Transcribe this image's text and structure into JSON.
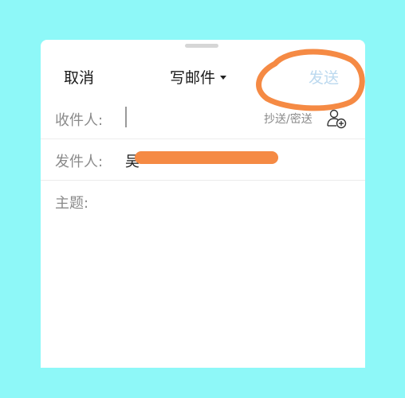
{
  "header": {
    "cancel_label": "取消",
    "title": "写邮件",
    "send_label": "发送",
    "send_color": "#bcd9ef"
  },
  "fields": {
    "to": {
      "label": "收件人:",
      "value": "",
      "cc_bcc_label": "抄送/密送",
      "add_icon": "add-contact-icon"
    },
    "from": {
      "label": "发件人:",
      "value": "吴"
    },
    "subject": {
      "label": "主题:",
      "value": ""
    }
  },
  "colors": {
    "background": "#8ef8f8",
    "annotation": "#f58a44"
  }
}
